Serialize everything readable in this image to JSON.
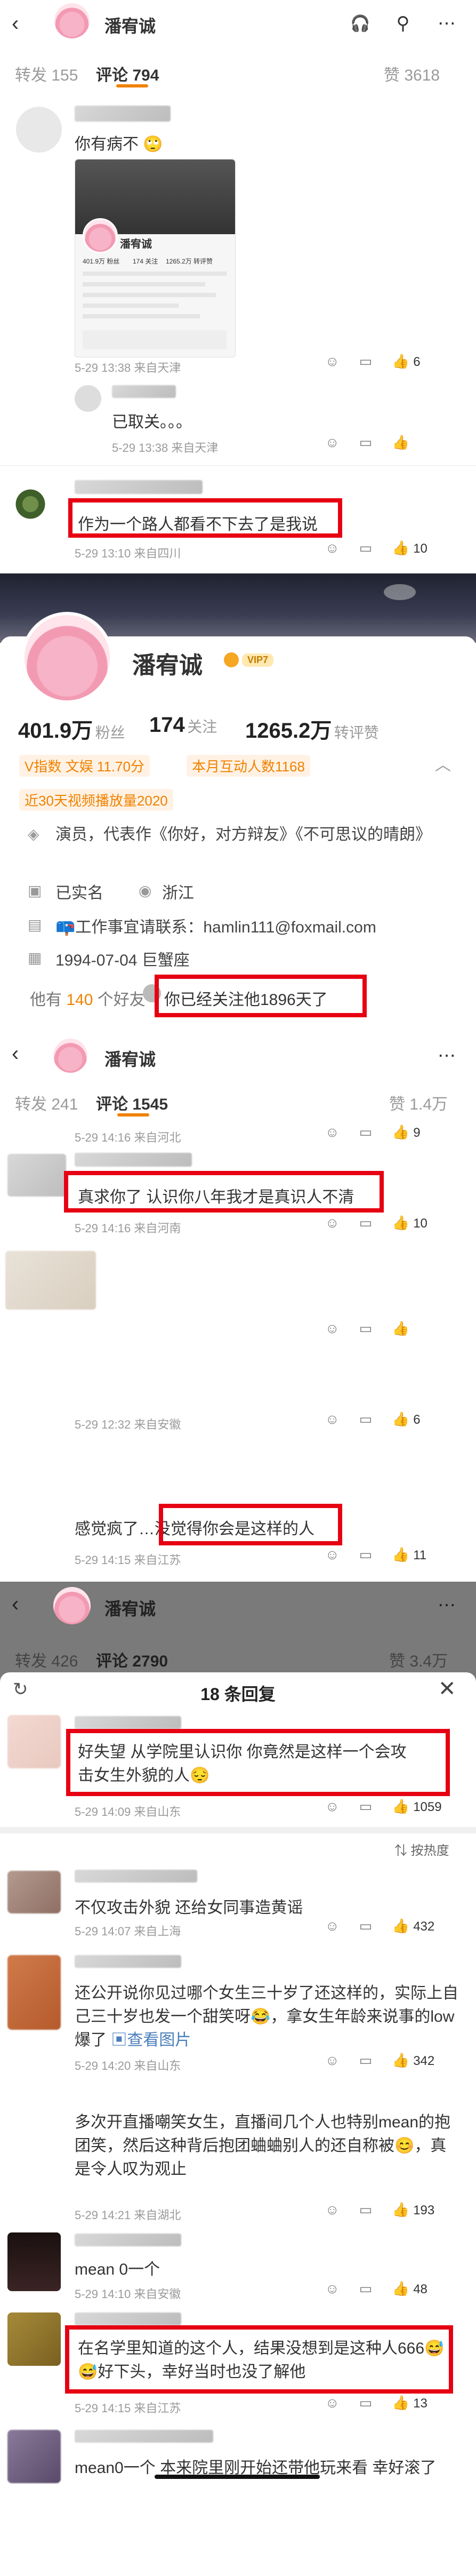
{
  "colors": {
    "accent": "#f08200",
    "red_box": "#e60012",
    "muted": "#9a9a9a"
  },
  "section1": {
    "username": "潘宥诚",
    "header_icons": [
      "listen-icon",
      "search-icon",
      "more-icon"
    ],
    "tab_repost": "转发 155",
    "tab_comment": "评论 794",
    "tab_like": "赞 3618",
    "comment1": {
      "text": "你有病不",
      "time": "5-29 13:38",
      "location": "来自天津",
      "likes": "6",
      "card": {
        "name": "潘宥诚",
        "stats": [
          "401.9万 粉丝",
          "174 关注",
          "1265.2万 转评赞"
        ]
      }
    },
    "reply1": {
      "text": "已取关。。。",
      "time": "5-29 13:38",
      "location": "来自天津"
    },
    "comment2": {
      "text": "作为一个路人都看不下去了是我说",
      "time": "5-29 13:10",
      "location": "来自四川",
      "likes": "10"
    }
  },
  "profile": {
    "name": "潘宥诚",
    "vip_badge": "VIP7",
    "followers_num": "401.9万",
    "followers_label": "粉丝",
    "following_num": "174",
    "following_label": "关注",
    "engagement_num": "1265.2万",
    "engagement_label": "转评赞",
    "v_index": "V指数 文娱 11.70分",
    "monthly_interactions": "本月互动人数1168",
    "video_plays": "近30天视频播放量2020",
    "bio": "演员，代表作《你好，对方辩友》《不可思议的晴朗》",
    "verified": "已实名",
    "province": "浙江",
    "contact": "📪工作事宜请联系：hamlin111@foxmail.com",
    "birthday": "1994-07-04 巨蟹座",
    "mutual_prefix": "他有",
    "mutual_count": "140",
    "mutual_suffix": "个好友",
    "followed_days": "你已经关注他1896天了"
  },
  "section2": {
    "username": "潘宥诚",
    "tab_repost": "转发 241",
    "tab_comment": "评论 1545",
    "tab_like": "赞 1.4万",
    "row0": {
      "time": "5-29 14:16",
      "location": "来自河北",
      "likes": "9"
    },
    "comment1": {
      "text": "真求你了 认识你八年我才是真识人不清",
      "time": "5-29 14:16",
      "location": "来自河南",
      "likes": "10"
    },
    "comment2": {
      "time": "5-29 12:32",
      "location": "来自安徽",
      "likes": "6"
    },
    "comment3": {
      "text_prefix": "感觉疯了…",
      "text_boxed": "没觉得你会是这样的人",
      "time": "5-29 14:15",
      "location": "来自江苏",
      "likes": "11"
    }
  },
  "section3": {
    "username": "潘宥诚",
    "tab_repost": "转发 426",
    "tab_comment": "评论 2790",
    "tab_like": "赞 3.4万",
    "modal_title": "18 条回复",
    "top_comment": {
      "text": "好失望 从学院里认识你 你竟然是这样一个会攻击女生外貌的人😔",
      "time": "5-29 14:09",
      "location": "来自山东",
      "likes": "1059"
    },
    "sort_label": "按热度",
    "replies": [
      {
        "text": "不仅攻击外貌 还给女同事造黄谣",
        "time": "5-29 14:07",
        "location": "来自上海",
        "likes": "432"
      },
      {
        "text": "还公开说你见过哪个女生三十岁了还这样的，实际上自己三十岁也发一个甜笑呀😂，拿女生年龄来说事的low爆了",
        "link": "查看图片",
        "time": "5-29 14:20",
        "location": "来自山东",
        "likes": "342"
      },
      {
        "text": "多次开直播嘲笑女生，直播间几个人也特别mean的抱团笑，然后这种背后抱团蛐蛐别人的还自称被😊，真是令人叹为观止",
        "time": "5-29 14:21",
        "location": "来自湖北",
        "likes": "193"
      },
      {
        "text": "mean 0一个",
        "time": "5-29 14:10",
        "location": "来自安徽",
        "likes": "48"
      },
      {
        "text": "在名学里知道的这个人，结果没想到是这种人666😅😅好下头，幸好当时也没了解他",
        "time": "5-29 14:15",
        "location": "来自江苏",
        "likes": "13"
      },
      {
        "text": "mean0一个 本来院里刚开始还带他玩来看 幸好滚了"
      }
    ]
  }
}
